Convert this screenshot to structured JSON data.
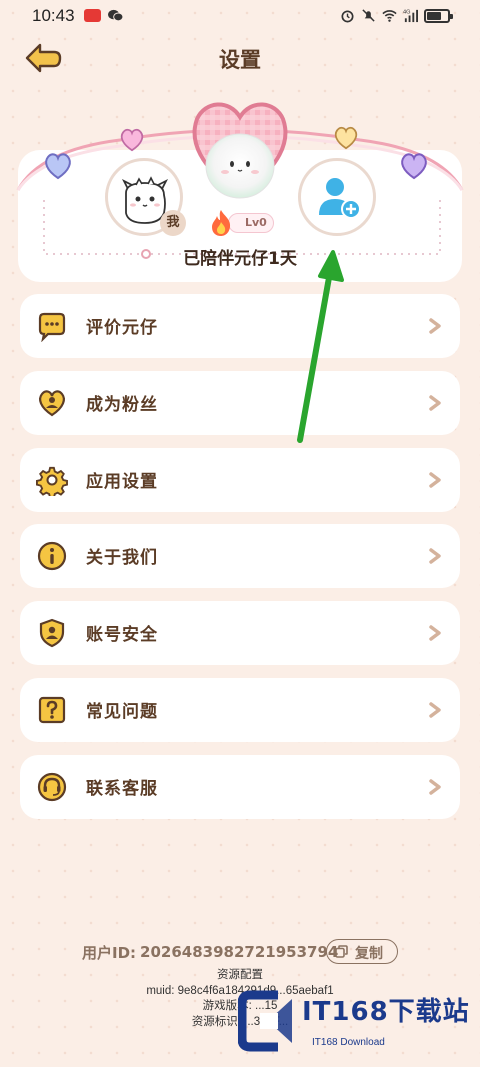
{
  "status_bar": {
    "time": "10:43",
    "network": "4G"
  },
  "header": {
    "title": "设置"
  },
  "companion": {
    "me_label": "我",
    "level": "Lv0",
    "days_text": "已陪伴元仔1天"
  },
  "menu": {
    "items": [
      {
        "label": "评价元仔",
        "icon": "chat-bubble-icon"
      },
      {
        "label": "成为粉丝",
        "icon": "heart-icon"
      },
      {
        "label": "应用设置",
        "icon": "gear-icon"
      },
      {
        "label": "关于我们",
        "icon": "info-icon"
      },
      {
        "label": "账号安全",
        "icon": "shield-user-icon"
      },
      {
        "label": "常见问题",
        "icon": "question-icon"
      },
      {
        "label": "联系客服",
        "icon": "headset-icon"
      }
    ]
  },
  "footer": {
    "user_id_label": "用户ID:",
    "user_id_value": "2026483982721953794",
    "copy_label": "复制",
    "resource_config": "资源配置",
    "muid": "muid: 9e8c4f6a184291d9...65aebaf1",
    "game_version": "游戏版本: ...15",
    "resource_tag": "资源标识: ...312F..."
  },
  "watermark": {
    "text": "IT168下载站",
    "sub": "IT168 Download"
  },
  "colors": {
    "accent_brown": "#5b3c26",
    "card_bg": "#ffffff",
    "icon_gold": "#f5c542",
    "arrow_green": "#2aa52e"
  }
}
